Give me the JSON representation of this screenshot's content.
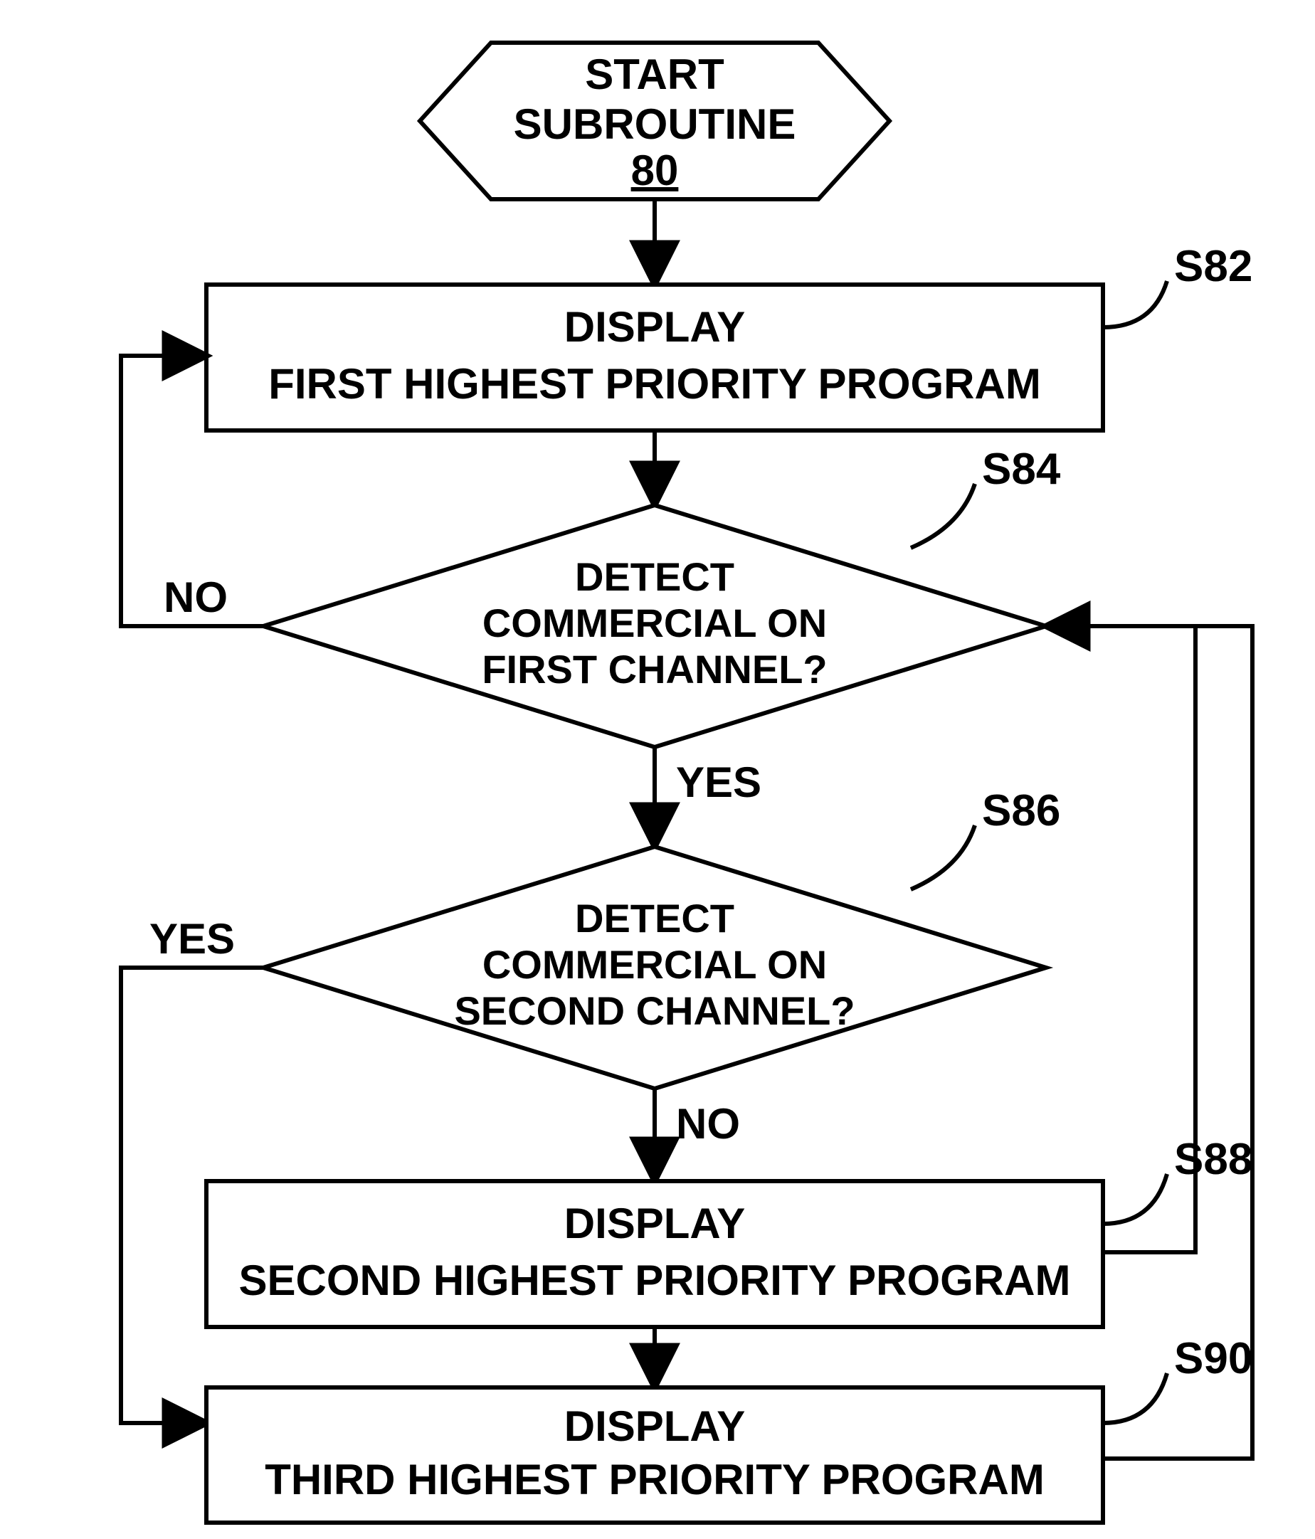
{
  "chart_data": {
    "type": "flowchart",
    "nodes": [
      {
        "id": "start",
        "shape": "hexagon",
        "lines": [
          "START",
          "SUBROUTINE"
        ],
        "ref": "80",
        "ref_underlined": true,
        "step_label": ""
      },
      {
        "id": "s82",
        "shape": "process",
        "lines": [
          "DISPLAY",
          "FIRST HIGHEST PRIORITY PROGRAM"
        ],
        "step_label": "S82"
      },
      {
        "id": "s84",
        "shape": "decision",
        "lines": [
          "DETECT",
          "COMMERCIAL ON",
          "FIRST CHANNEL?"
        ],
        "step_label": "S84"
      },
      {
        "id": "s86",
        "shape": "decision",
        "lines": [
          "DETECT",
          "COMMERCIAL ON",
          "SECOND CHANNEL?"
        ],
        "step_label": "S86"
      },
      {
        "id": "s88",
        "shape": "process",
        "lines": [
          "DISPLAY",
          "SECOND HIGHEST PRIORITY PROGRAM"
        ],
        "step_label": "S88"
      },
      {
        "id": "s90",
        "shape": "process",
        "lines": [
          "DISPLAY",
          "THIRD HIGHEST PRIORITY PROGRAM"
        ],
        "step_label": "S90"
      }
    ],
    "edges": [
      {
        "from": "start",
        "to": "s82",
        "label": ""
      },
      {
        "from": "s82",
        "to": "s84",
        "label": ""
      },
      {
        "from": "s84",
        "to": "s82",
        "label": "NO",
        "via": "left"
      },
      {
        "from": "s84",
        "to": "s86",
        "label": "YES"
      },
      {
        "from": "s86",
        "to": "s90",
        "label": "YES",
        "via": "left"
      },
      {
        "from": "s86",
        "to": "s88",
        "label": "NO"
      },
      {
        "from": "s88",
        "to": "s84",
        "label": "",
        "via": "right"
      },
      {
        "from": "s88",
        "to": "s90",
        "label": ""
      },
      {
        "from": "s90",
        "to": "s84",
        "label": "",
        "via": "right"
      }
    ]
  },
  "labels": {
    "no": "NO",
    "yes": "YES"
  }
}
